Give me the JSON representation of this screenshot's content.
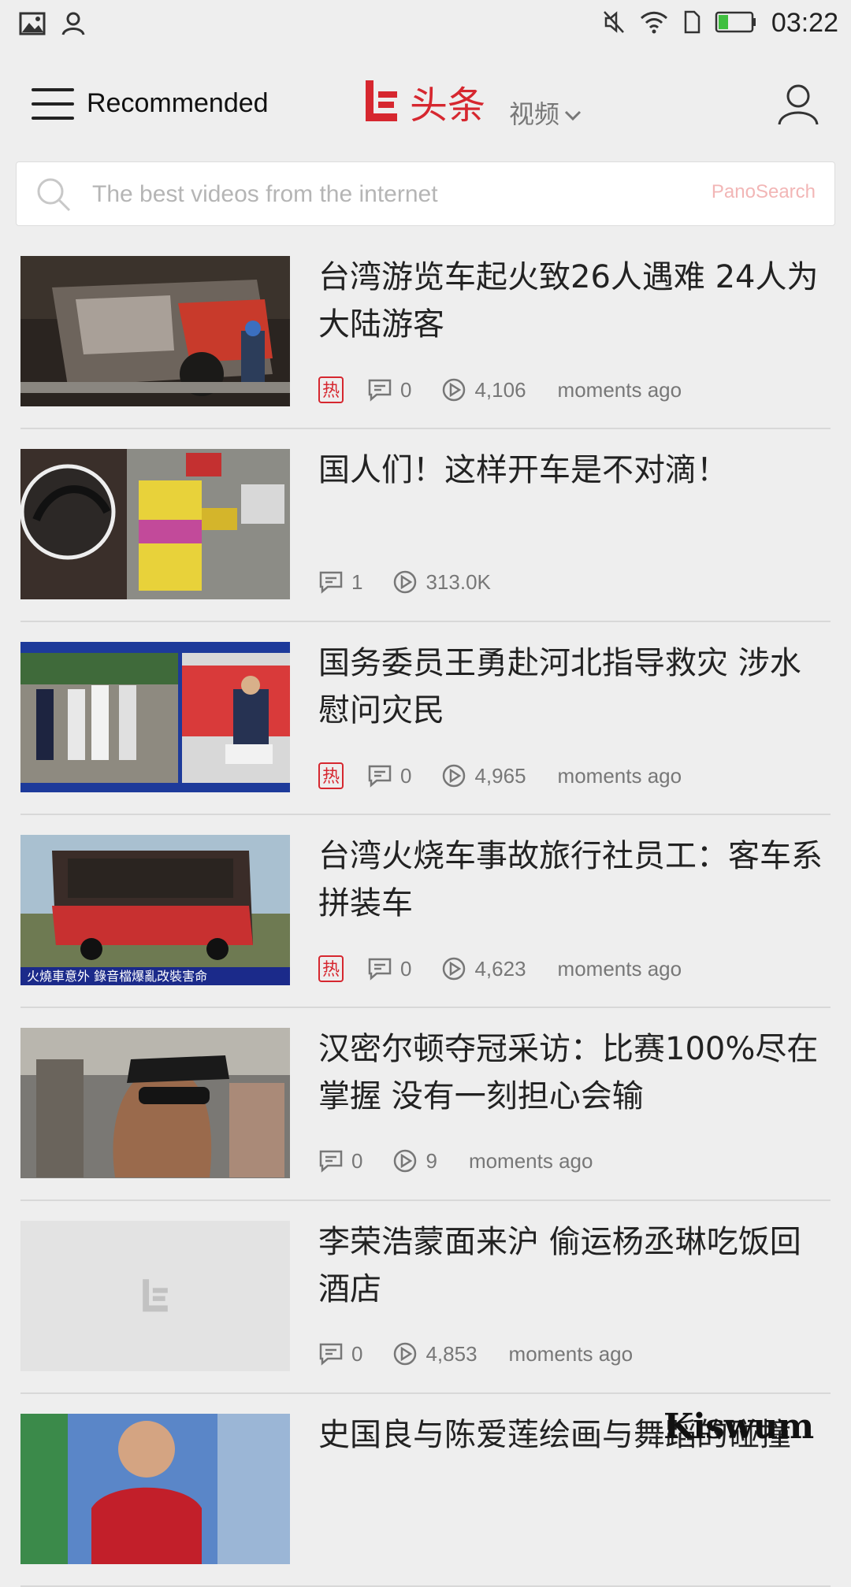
{
  "status_bar": {
    "time": "03:22",
    "icons": [
      "image-icon",
      "person-icon",
      "mute-icon",
      "wifi-icon",
      "sim-icon",
      "battery-icon"
    ]
  },
  "header": {
    "title": "Recommended",
    "brand_text": "头条",
    "video_tab": "视频"
  },
  "search": {
    "placeholder": "The best videos from the internet",
    "provider": "PanoSearch"
  },
  "colors": {
    "brand_red": "#d6272f",
    "bg": "#eeeeee"
  },
  "feed": [
    {
      "title": "台湾游览车起火致26人遇难 24人为大陆游客",
      "hot": true,
      "comments": "0",
      "views": "4,106",
      "time": "moments ago",
      "hot_label": "热"
    },
    {
      "title": "国人们！这样开车是不对滴！",
      "hot": false,
      "comments": "1",
      "views": "313.0K",
      "time": ""
    },
    {
      "title": "国务委员王勇赴河北指导救灾 涉水慰问灾民",
      "hot": true,
      "comments": "0",
      "views": "4,965",
      "time": "moments ago",
      "hot_label": "热"
    },
    {
      "title": "台湾火烧车事故旅行社员工：客车系拼装车",
      "hot": true,
      "comments": "0",
      "views": "4,623",
      "time": "moments ago",
      "hot_label": "热"
    },
    {
      "title": "汉密尔顿夺冠采访：比赛100%尽在掌握 没有一刻担心会输",
      "hot": false,
      "comments": "0",
      "views": "9",
      "time": "moments ago"
    },
    {
      "title": "李荣浩蒙面来沪 偷运杨丞琳吃饭回酒店",
      "hot": false,
      "comments": "0",
      "views": "4,853",
      "time": "moments ago"
    },
    {
      "title": "史国良与陈爱莲绘画与舞蹈的碰撞",
      "hot": false,
      "comments": "",
      "views": "",
      "time": ""
    }
  ],
  "thumbnail_captions": {
    "item1": "火燒車意外 錄音檔爆亂改裝害命"
  },
  "watermark": "Kiswum"
}
